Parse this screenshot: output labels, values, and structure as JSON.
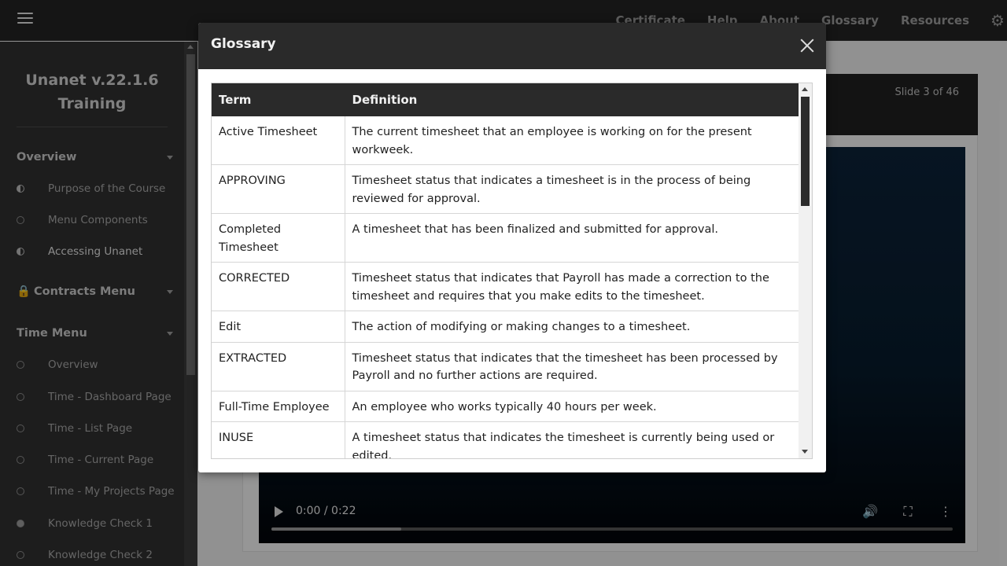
{
  "topbar": {
    "nav": [
      "Certificate",
      "Help",
      "About",
      "Glossary",
      "Resources"
    ],
    "menu_icon": "hamburger-icon",
    "settings_icon": "gear-icon"
  },
  "sidebar": {
    "title_line1": "Unanet v.22.1.6",
    "title_line2": "Training",
    "sections": [
      {
        "label": "Overview",
        "locked": false,
        "items": [
          {
            "label": "Purpose of the Course",
            "status": "half"
          },
          {
            "label": "Menu Components",
            "status": "empty"
          },
          {
            "label": "Accessing Unanet",
            "status": "half",
            "active": true
          }
        ]
      },
      {
        "label": "Contracts Menu",
        "locked": true,
        "items": []
      },
      {
        "label": "Time Menu",
        "locked": false,
        "items": [
          {
            "label": "Overview",
            "status": "empty"
          },
          {
            "label": "Time - Dashboard Page",
            "status": "empty"
          },
          {
            "label": "Time - List Page",
            "status": "empty"
          },
          {
            "label": "Time - Current Page",
            "status": "empty"
          },
          {
            "label": "Time - My Projects Page",
            "status": "empty"
          },
          {
            "label": "Knowledge Check 1",
            "status": "full"
          },
          {
            "label": "Knowledge Check 2",
            "status": "empty"
          }
        ]
      }
    ]
  },
  "slide": {
    "counter": "Slide 3 of 46",
    "video_time": "0:00 / 0:22",
    "video_progress": 0.19
  },
  "glossary": {
    "title": "Glossary",
    "headers": {
      "term": "Term",
      "definition": "Definition"
    },
    "rows": [
      {
        "term": "Active Timesheet",
        "definition": "The current timesheet that an employee is working on for the present workweek."
      },
      {
        "term": "APPROVING",
        "definition": "Timesheet status that indicates a timesheet is in the process of being reviewed for approval."
      },
      {
        "term": "Completed Timesheet",
        "definition": "A timesheet that has been finalized and submitted for approval."
      },
      {
        "term": "CORRECTED",
        "definition": "Timesheet status that indicates that Payroll has made a correction to the timesheet and requires that you make edits to the timesheet."
      },
      {
        "term": "Edit",
        "definition": "The action of modifying or making changes to a timesheet."
      },
      {
        "term": "EXTRACTED",
        "definition": "Timesheet status that indicates that the timesheet has been processed by Payroll and no further actions are required."
      },
      {
        "term": "Full-Time Employee",
        "definition": "An employee who works typically 40 hours per week."
      },
      {
        "term": "INUSE",
        "definition": "A timesheet status that indicates the timesheet is currently being used or edited."
      }
    ]
  }
}
